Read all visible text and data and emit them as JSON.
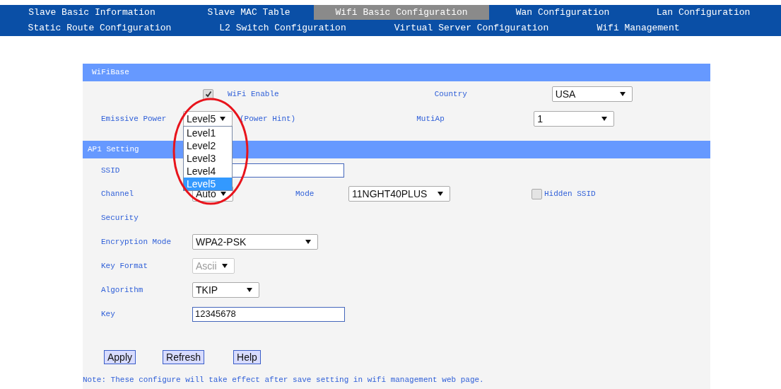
{
  "nav": [
    [
      {
        "label": "Slave Basic Information",
        "selected": false
      },
      {
        "label": "Slave MAC Table",
        "selected": false
      },
      {
        "label": "Wifi Basic Configuration",
        "selected": true
      },
      {
        "label": "Wan Configuration",
        "selected": false
      },
      {
        "label": "Lan Configuration",
        "selected": false
      }
    ],
    [
      {
        "label": "Static Route Configuration",
        "selected": false
      },
      {
        "label": "L2 Switch Configuration",
        "selected": false
      },
      {
        "label": "Virtual Server Configuration",
        "selected": false
      },
      {
        "label": "Wifi Management",
        "selected": false
      }
    ]
  ],
  "wifi_base": {
    "title": "WiFiBase",
    "wifi_enable": {
      "label": "WiFi Enable",
      "checked": true
    },
    "country": {
      "label": "Country",
      "value": "USA"
    },
    "emissive_power": {
      "label": "Emissive Power",
      "value": "Level5",
      "hint": "(Power Hint)",
      "expanded": true,
      "options": [
        {
          "label": "Level1",
          "selected": false
        },
        {
          "label": "Level2",
          "selected": false
        },
        {
          "label": "Level3",
          "selected": false
        },
        {
          "label": "Level4",
          "selected": false
        },
        {
          "label": "Level5",
          "selected": true
        }
      ]
    },
    "muti_ap": {
      "label": "MutiAp",
      "value": "1"
    }
  },
  "ap1": {
    "title": "AP1 Setting",
    "ssid": {
      "label": "SSID"
    },
    "channel": {
      "label": "Channel",
      "value": "Auto"
    },
    "mode": {
      "label": "Mode",
      "value": "11NGHT40PLUS"
    },
    "hidden_ssid": {
      "label": "Hidden SSID",
      "checked": false
    },
    "security": {
      "label": "Security"
    },
    "encryption_mode": {
      "label": "Encryption Mode",
      "value": "WPA2-PSK"
    },
    "key_format": {
      "label": "Key Format",
      "value": "Ascii",
      "disabled": true
    },
    "algorithm": {
      "label": "Algorithm",
      "value": "TKIP"
    },
    "key": {
      "label": "Key",
      "value": "12345678"
    }
  },
  "buttons": [
    "Apply",
    "Refresh",
    "Help"
  ],
  "note": "Note: These configure will take effect after save setting in wifi management web page."
}
